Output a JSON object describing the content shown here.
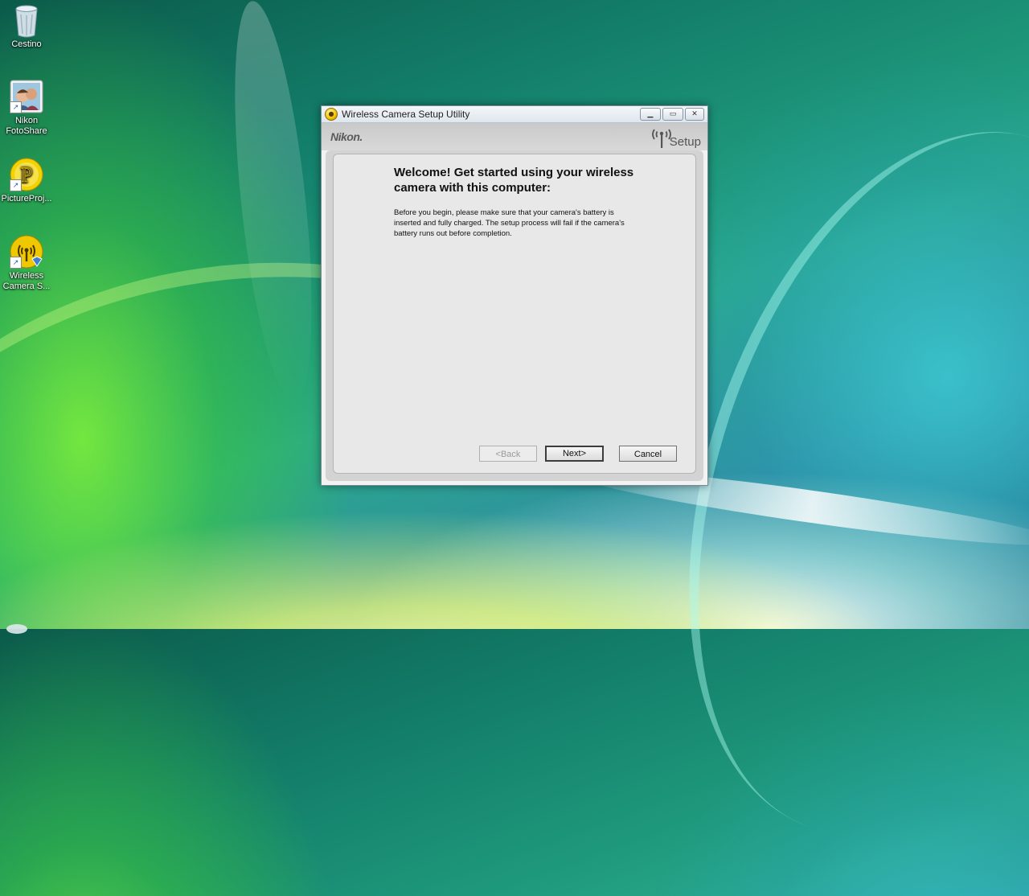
{
  "desktop": {
    "icons": [
      {
        "label": "Cestino",
        "icon": "recycle-bin-icon"
      },
      {
        "label": "Nikon\nFotoShare",
        "icon": "fotoshare-icon"
      },
      {
        "label": "PictureProj...",
        "icon": "pictureproject-icon"
      },
      {
        "label": "Wireless\nCamera S...",
        "icon": "wireless-camera-setup-icon"
      }
    ]
  },
  "window": {
    "title": "Wireless Camera Setup Utility",
    "brand": "Nikon.",
    "setup_logo": "Setup",
    "heading": "Welcome! Get started using your wireless camera with this computer:",
    "body": "Before you begin, please make sure that your camera's battery is inserted and fully charged. The setup process will fail if the camera's battery runs out before completion.",
    "buttons": {
      "back": "<Back",
      "next": "Next>",
      "cancel": "Cancel"
    }
  },
  "colors": {
    "window_bg": "#f2f2f2",
    "panel_bg": "#e8e8e8",
    "header_bg": "#d0d0d0"
  }
}
